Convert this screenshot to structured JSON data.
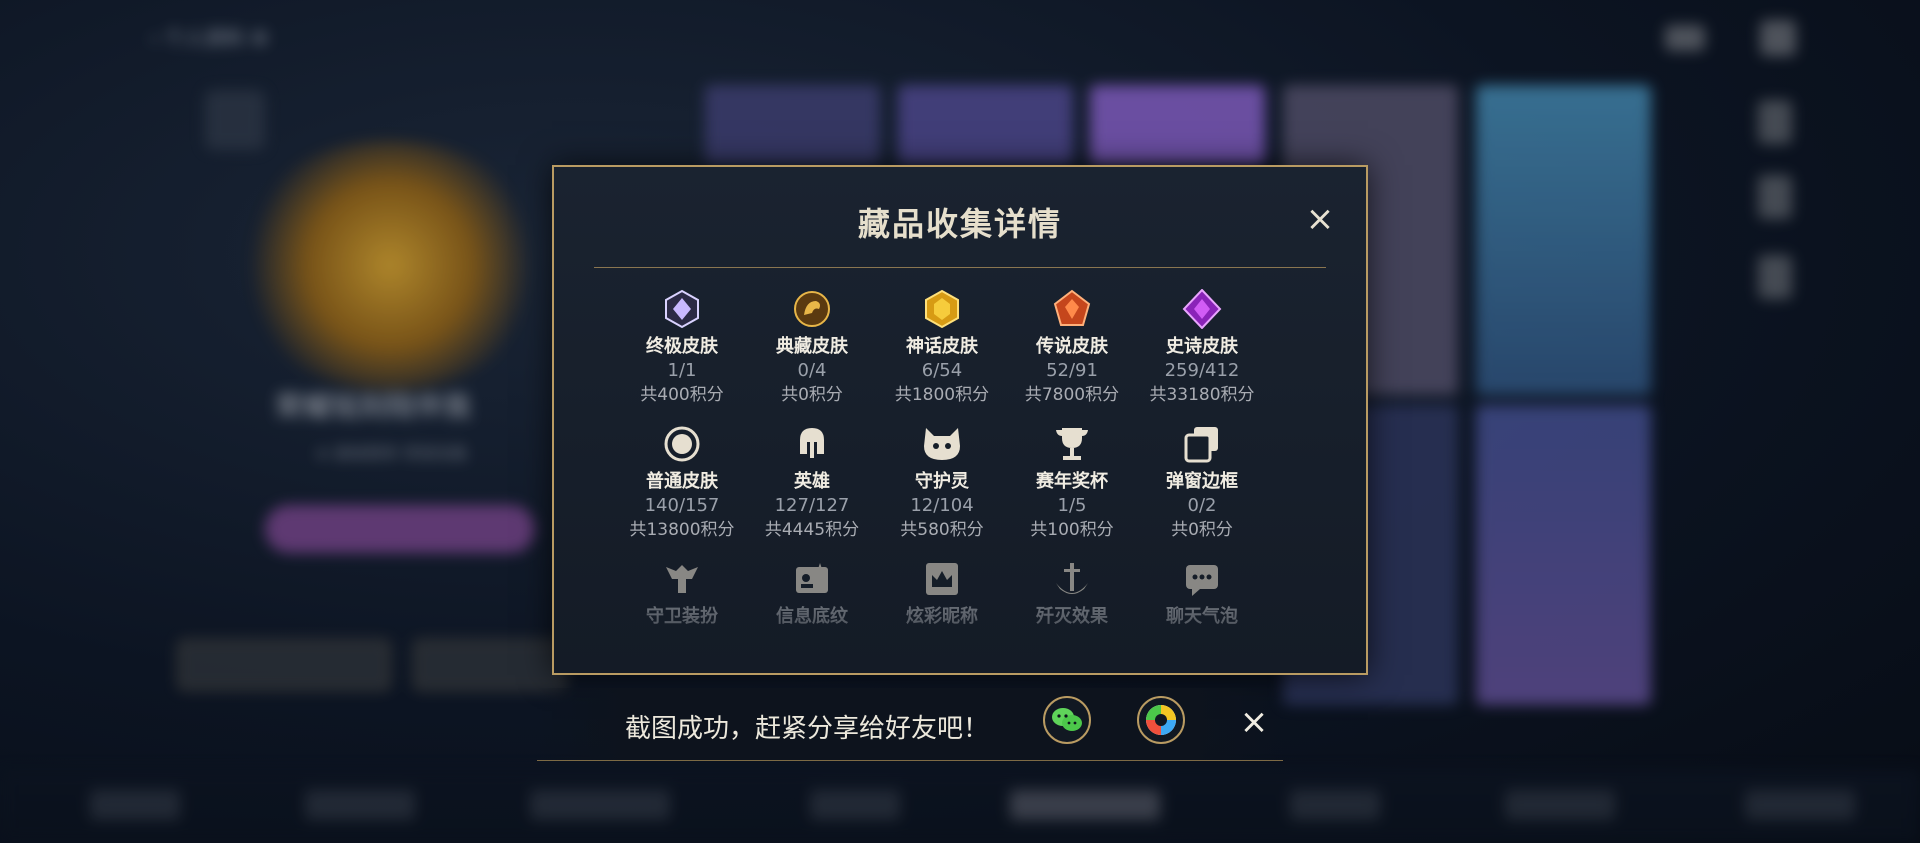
{
  "modal": {
    "title": "藏品收集详情",
    "close_icon": "×",
    "items": [
      {
        "name": "终极皮肤",
        "count": "1/1",
        "points": "共400积分",
        "icon": "ultimate-skin-icon",
        "color": "#b9a9ff"
      },
      {
        "name": "典藏皮肤",
        "count": "0/4",
        "points": "共0积分",
        "icon": "legendary-collection-icon",
        "color": "#e2a93a"
      },
      {
        "name": "神话皮肤",
        "count": "6/54",
        "points": "共1800积分",
        "icon": "mythic-skin-icon",
        "color": "#f0c43a"
      },
      {
        "name": "传说皮肤",
        "count": "52/91",
        "points": "共7800积分",
        "icon": "legend-skin-icon",
        "color": "#f07a3a"
      },
      {
        "name": "史诗皮肤",
        "count": "259/412",
        "points": "共33180积分",
        "icon": "epic-skin-icon",
        "color": "#b84ee0"
      },
      {
        "name": "普通皮肤",
        "count": "140/157",
        "points": "共13800积分",
        "icon": "normal-skin-icon",
        "color": "#e6dfd0"
      },
      {
        "name": "英雄",
        "count": "127/127",
        "points": "共4445积分",
        "icon": "hero-helmet-icon",
        "color": "#e6dfd0"
      },
      {
        "name": "守护灵",
        "count": "12/104",
        "points": "共580积分",
        "icon": "guardian-spirit-icon",
        "color": "#e6dfd0"
      },
      {
        "name": "赛年奖杯",
        "count": "1/5",
        "points": "共100积分",
        "icon": "trophy-icon",
        "color": "#e6dfd0"
      },
      {
        "name": "弹窗边框",
        "count": "0/2",
        "points": "共0积分",
        "icon": "popup-frame-icon",
        "color": "#e6dfd0"
      },
      {
        "name": "守卫装扮",
        "icon": "guard-outfit-icon",
        "color": "#e6dfd0"
      },
      {
        "name": "信息底纹",
        "icon": "info-pattern-icon",
        "color": "#e6dfd0"
      },
      {
        "name": "炫彩昵称",
        "icon": "colorful-nickname-icon",
        "color": "#e6dfd0"
      },
      {
        "name": "歼灭效果",
        "icon": "annihilation-effect-icon",
        "color": "#e6dfd0"
      },
      {
        "name": "聊天气泡",
        "icon": "chat-bubble-icon",
        "color": "#e6dfd0"
      }
    ]
  },
  "share": {
    "text": "截图成功，赶紧分享给好友吧！",
    "wechat_icon": "wechat-icon",
    "moments_icon": "moments-icon",
    "close_icon": "×"
  },
  "colors": {
    "accent_gold": "#b99b62",
    "panel_bg": "#161e29"
  }
}
